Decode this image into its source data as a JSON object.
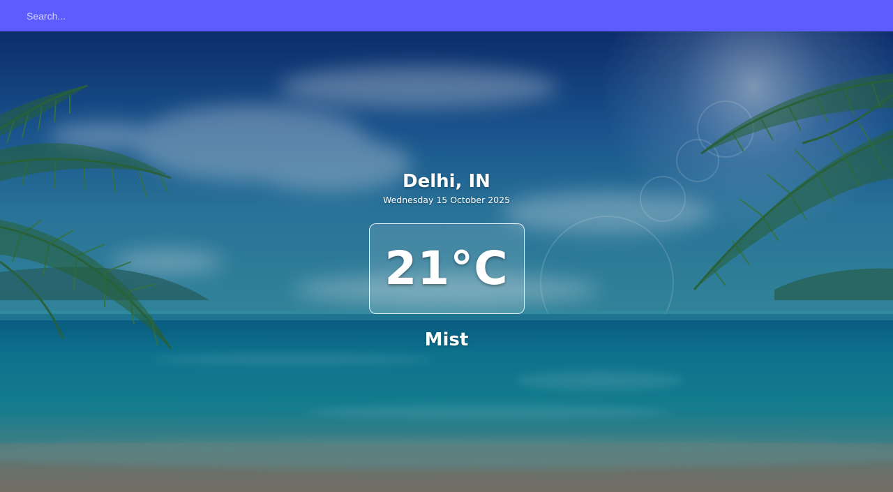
{
  "search": {
    "placeholder": "Search..."
  },
  "weather": {
    "location": "Delhi, IN",
    "date": "Wednesday 15 October 2025",
    "temperature": "21°C",
    "condition": "Mist"
  },
  "colors": {
    "topbar": "#5c5cff",
    "text": "#ffffff",
    "sky_top": "#0c2a6e",
    "sea": "#0e8a99",
    "sand": "#8a7a66"
  },
  "background": {
    "icon": "tropical-beach-background"
  }
}
